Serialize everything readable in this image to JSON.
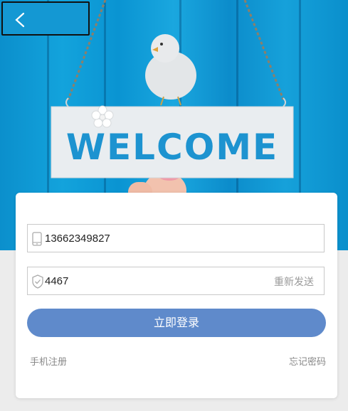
{
  "header": {
    "back_icon": "chevron-left-icon",
    "sign_text": "WELCOME"
  },
  "form": {
    "phone_value": "13662349827",
    "phone_icon": "phone-icon",
    "code_value": "4467",
    "code_icon": "shield-check-icon",
    "resend_label": "重新发送",
    "login_label": "立即登录",
    "register_label": "手机注册",
    "forgot_label": "忘记密码"
  },
  "colors": {
    "accent": "#5f8acb",
    "hero_blue": "#1498d3"
  }
}
